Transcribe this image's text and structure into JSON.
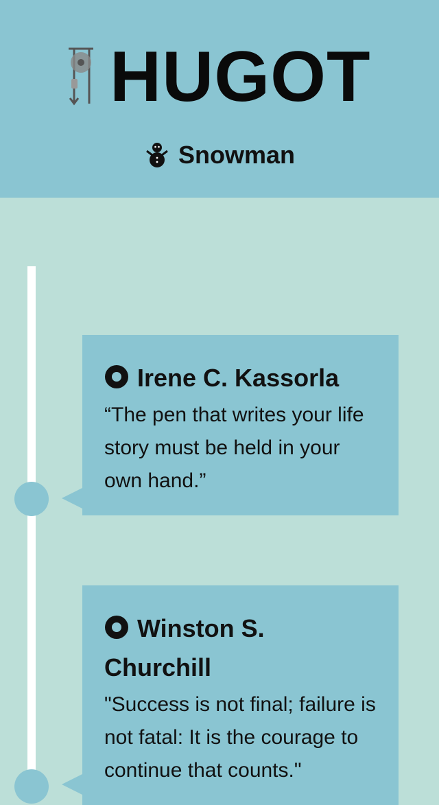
{
  "header": {
    "logo_text": "HUGOT",
    "logo_icon": "pulley-icon",
    "subtitle": "Snowman",
    "subtitle_icon": "snowman-icon"
  },
  "timeline": {
    "items": [
      {
        "author": "Irene C. Kassorla",
        "quote": "“The pen that writes your life story must be held in your own hand.”",
        "icon": "circle-dot-icon"
      },
      {
        "author": "Winston S. Churchill",
        "quote": "\"Success is not final; failure is not fatal: It is the courage to continue that counts.\"",
        "icon": "circle-dot-icon"
      }
    ]
  },
  "colors": {
    "header_bg": "#8ac5d2",
    "page_bg": "#bcdfd8",
    "card_bg": "#8ac5d2",
    "timeline_line": "#ffffff",
    "text": "#111111"
  }
}
